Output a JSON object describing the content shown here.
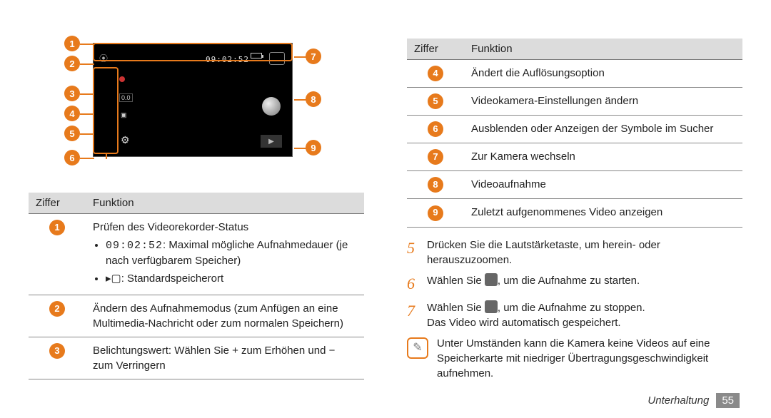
{
  "camera": {
    "timer": "09:02:52",
    "markers": [
      "1",
      "2",
      "3",
      "4",
      "5",
      "6",
      "7",
      "8",
      "9"
    ]
  },
  "table_left": {
    "header": {
      "num": "Ziffer",
      "func": "Funktion"
    },
    "rows": [
      {
        "badge": "1",
        "title": "Prüfen des Videorekorder-Status",
        "sub1_code": "09:02:52",
        "sub1_text": ": Maximal mögliche Aufnahmedauer (je nach verfügbarem Speicher)",
        "sub2_text": ": Standardspeicherort"
      },
      {
        "badge": "2",
        "text": "Ändern des Aufnahmemodus (zum Anfügen an eine Multimedia-Nachricht oder zum normalen Speichern)"
      },
      {
        "badge": "3",
        "text": "Belichtungswert: Wählen Sie + zum Erhöhen und − zum Verringern"
      }
    ]
  },
  "table_right": {
    "header": {
      "num": "Ziffer",
      "func": "Funktion"
    },
    "rows": [
      {
        "badge": "4",
        "text": "Ändert die Auflösungsoption"
      },
      {
        "badge": "5",
        "text": "Videokamera-Einstellungen ändern"
      },
      {
        "badge": "6",
        "text": "Ausblenden oder Anzeigen der Symbole im Sucher"
      },
      {
        "badge": "7",
        "text": "Zur Kamera wechseln"
      },
      {
        "badge": "8",
        "text": "Videoaufnahme"
      },
      {
        "badge": "9",
        "text": "Zuletzt aufgenommenes Video anzeigen"
      }
    ]
  },
  "steps": {
    "s5": "Drücken Sie die Lautstärketaste, um herein- oder herauszuzoomen.",
    "s6a": "Wählen Sie ",
    "s6b": ", um die Aufnahme zu starten.",
    "s7a": "Wählen Sie ",
    "s7b": ", um die Aufnahme zu stoppen.",
    "s7c": "Das Video wird automatisch gespeichert."
  },
  "step_numbers": {
    "n5": "5",
    "n6": "6",
    "n7": "7"
  },
  "note": "Unter Umständen kann die Kamera keine Videos auf eine Speicherkarte mit niedriger Übertragungsgeschwindigkeit aufnehmen.",
  "footer": {
    "section": "Unterhaltung",
    "page": "55"
  }
}
